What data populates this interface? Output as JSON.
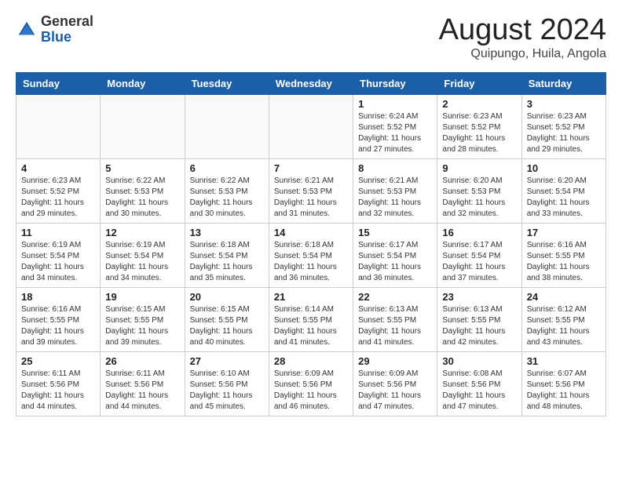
{
  "header": {
    "logo_general": "General",
    "logo_blue": "Blue",
    "month_title": "August 2024",
    "location": "Quipungo, Huila, Angola"
  },
  "weekdays": [
    "Sunday",
    "Monday",
    "Tuesday",
    "Wednesday",
    "Thursday",
    "Friday",
    "Saturday"
  ],
  "weeks": [
    [
      {
        "day": "",
        "info": ""
      },
      {
        "day": "",
        "info": ""
      },
      {
        "day": "",
        "info": ""
      },
      {
        "day": "",
        "info": ""
      },
      {
        "day": "1",
        "info": "Sunrise: 6:24 AM\nSunset: 5:52 PM\nDaylight: 11 hours and 27 minutes."
      },
      {
        "day": "2",
        "info": "Sunrise: 6:23 AM\nSunset: 5:52 PM\nDaylight: 11 hours and 28 minutes."
      },
      {
        "day": "3",
        "info": "Sunrise: 6:23 AM\nSunset: 5:52 PM\nDaylight: 11 hours and 29 minutes."
      }
    ],
    [
      {
        "day": "4",
        "info": "Sunrise: 6:23 AM\nSunset: 5:52 PM\nDaylight: 11 hours and 29 minutes."
      },
      {
        "day": "5",
        "info": "Sunrise: 6:22 AM\nSunset: 5:53 PM\nDaylight: 11 hours and 30 minutes."
      },
      {
        "day": "6",
        "info": "Sunrise: 6:22 AM\nSunset: 5:53 PM\nDaylight: 11 hours and 30 minutes."
      },
      {
        "day": "7",
        "info": "Sunrise: 6:21 AM\nSunset: 5:53 PM\nDaylight: 11 hours and 31 minutes."
      },
      {
        "day": "8",
        "info": "Sunrise: 6:21 AM\nSunset: 5:53 PM\nDaylight: 11 hours and 32 minutes."
      },
      {
        "day": "9",
        "info": "Sunrise: 6:20 AM\nSunset: 5:53 PM\nDaylight: 11 hours and 32 minutes."
      },
      {
        "day": "10",
        "info": "Sunrise: 6:20 AM\nSunset: 5:54 PM\nDaylight: 11 hours and 33 minutes."
      }
    ],
    [
      {
        "day": "11",
        "info": "Sunrise: 6:19 AM\nSunset: 5:54 PM\nDaylight: 11 hours and 34 minutes."
      },
      {
        "day": "12",
        "info": "Sunrise: 6:19 AM\nSunset: 5:54 PM\nDaylight: 11 hours and 34 minutes."
      },
      {
        "day": "13",
        "info": "Sunrise: 6:18 AM\nSunset: 5:54 PM\nDaylight: 11 hours and 35 minutes."
      },
      {
        "day": "14",
        "info": "Sunrise: 6:18 AM\nSunset: 5:54 PM\nDaylight: 11 hours and 36 minutes."
      },
      {
        "day": "15",
        "info": "Sunrise: 6:17 AM\nSunset: 5:54 PM\nDaylight: 11 hours and 36 minutes."
      },
      {
        "day": "16",
        "info": "Sunrise: 6:17 AM\nSunset: 5:54 PM\nDaylight: 11 hours and 37 minutes."
      },
      {
        "day": "17",
        "info": "Sunrise: 6:16 AM\nSunset: 5:55 PM\nDaylight: 11 hours and 38 minutes."
      }
    ],
    [
      {
        "day": "18",
        "info": "Sunrise: 6:16 AM\nSunset: 5:55 PM\nDaylight: 11 hours and 39 minutes."
      },
      {
        "day": "19",
        "info": "Sunrise: 6:15 AM\nSunset: 5:55 PM\nDaylight: 11 hours and 39 minutes."
      },
      {
        "day": "20",
        "info": "Sunrise: 6:15 AM\nSunset: 5:55 PM\nDaylight: 11 hours and 40 minutes."
      },
      {
        "day": "21",
        "info": "Sunrise: 6:14 AM\nSunset: 5:55 PM\nDaylight: 11 hours and 41 minutes."
      },
      {
        "day": "22",
        "info": "Sunrise: 6:13 AM\nSunset: 5:55 PM\nDaylight: 11 hours and 41 minutes."
      },
      {
        "day": "23",
        "info": "Sunrise: 6:13 AM\nSunset: 5:55 PM\nDaylight: 11 hours and 42 minutes."
      },
      {
        "day": "24",
        "info": "Sunrise: 6:12 AM\nSunset: 5:55 PM\nDaylight: 11 hours and 43 minutes."
      }
    ],
    [
      {
        "day": "25",
        "info": "Sunrise: 6:11 AM\nSunset: 5:56 PM\nDaylight: 11 hours and 44 minutes."
      },
      {
        "day": "26",
        "info": "Sunrise: 6:11 AM\nSunset: 5:56 PM\nDaylight: 11 hours and 44 minutes."
      },
      {
        "day": "27",
        "info": "Sunrise: 6:10 AM\nSunset: 5:56 PM\nDaylight: 11 hours and 45 minutes."
      },
      {
        "day": "28",
        "info": "Sunrise: 6:09 AM\nSunset: 5:56 PM\nDaylight: 11 hours and 46 minutes."
      },
      {
        "day": "29",
        "info": "Sunrise: 6:09 AM\nSunset: 5:56 PM\nDaylight: 11 hours and 47 minutes."
      },
      {
        "day": "30",
        "info": "Sunrise: 6:08 AM\nSunset: 5:56 PM\nDaylight: 11 hours and 47 minutes."
      },
      {
        "day": "31",
        "info": "Sunrise: 6:07 AM\nSunset: 5:56 PM\nDaylight: 11 hours and 48 minutes."
      }
    ]
  ]
}
